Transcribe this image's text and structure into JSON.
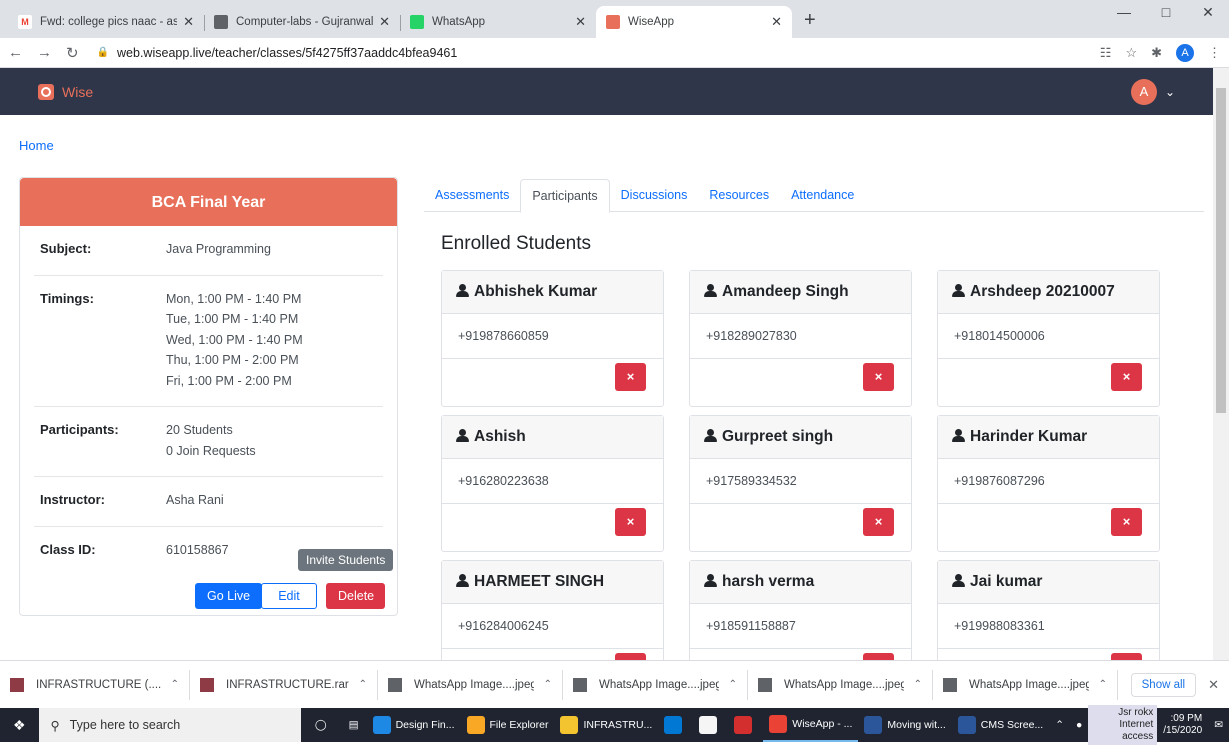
{
  "browser": {
    "tabs": [
      {
        "title": "Fwd: college pics naac - asharani",
        "fav_color": "#ffffff",
        "fav_text": "M",
        "fav_text_color": "#ea4335"
      },
      {
        "title": "Computer-labs - Gujranwala Guru",
        "fav_color": "#5f6368",
        "fav_text": "",
        "fav_text_color": "#ffffff"
      },
      {
        "title": "WhatsApp",
        "fav_color": "#25d366",
        "fav_text": "",
        "fav_text_color": "#ffffff"
      },
      {
        "title": "WiseApp",
        "fav_color": "#e8705a",
        "fav_text": "",
        "fav_text_color": "#ffffff",
        "active": true
      }
    ],
    "new_tab": "+",
    "url": "web.wiseapp.live/teacher/classes/5f4275ff37aaddc4bfea9461",
    "profile_initial": "A"
  },
  "app": {
    "brand": "Wise",
    "user_initial": "A",
    "breadcrumb": "Home"
  },
  "class": {
    "title": "BCA Final Year",
    "rows": [
      {
        "label": "Subject:",
        "value": "Java Programming"
      },
      {
        "label": "Timings:",
        "value": "Mon, 1:00 PM - 1:40 PM\nTue, 1:00 PM - 1:40 PM\nWed, 1:00 PM - 1:40 PM\nThu, 1:00 PM - 2:00 PM\nFri, 1:00 PM - 2:00 PM"
      },
      {
        "label": "Participants:",
        "value": "20 Students\n0 Join Requests"
      },
      {
        "label": "Instructor:",
        "value": "Asha Rani"
      },
      {
        "label": "Class ID:",
        "value": "610158867"
      }
    ],
    "invite_label": "Invite Students",
    "go_live_label": "Go Live",
    "edit_label": "Edit",
    "delete_label": "Delete"
  },
  "tabs": [
    "Assessments",
    "Participants",
    "Discussions",
    "Resources",
    "Attendance"
  ],
  "active_tab": "Participants",
  "enrolled_heading": "Enrolled Students",
  "students": [
    {
      "name": "Abhishek Kumar",
      "phone": "+919878660859"
    },
    {
      "name": "Amandeep Singh",
      "phone": "+918289027830"
    },
    {
      "name": "Arshdeep 20210007",
      "phone": "+918014500006"
    },
    {
      "name": "Ashish",
      "phone": "+916280223638"
    },
    {
      "name": "Gurpreet singh",
      "phone": "+917589334532"
    },
    {
      "name": "Harinder Kumar",
      "phone": "+919876087296"
    },
    {
      "name": "HARMEET SINGH",
      "phone": "+916284006245"
    },
    {
      "name": "harsh verma",
      "phone": "+918591158887"
    },
    {
      "name": "Jai kumar",
      "phone": "+919988083361"
    }
  ],
  "remove_glyph": "×",
  "downloads": [
    {
      "name": "INFRASTRUCTURE (....rar",
      "icon": "#8e3b46"
    },
    {
      "name": "INFRASTRUCTURE.rar",
      "icon": "#8e3b46"
    },
    {
      "name": "WhatsApp Image....jpeg",
      "icon": "#5f6368"
    },
    {
      "name": "WhatsApp Image....jpeg",
      "icon": "#5f6368"
    },
    {
      "name": "WhatsApp Image....jpeg",
      "icon": "#5f6368"
    },
    {
      "name": "WhatsApp Image....jpeg",
      "icon": "#5f6368"
    }
  ],
  "show_all_label": "Show all",
  "taskbar": {
    "search_placeholder": "Type here to search",
    "items": [
      {
        "label": "Design Fin...",
        "color": "#1e88e5"
      },
      {
        "label": "File Explorer",
        "color": "#f9a825"
      },
      {
        "label": "INFRASTRU...",
        "color": "#f4c430"
      },
      {
        "label": "",
        "color": "#0078d4"
      },
      {
        "label": "",
        "color": "#f5f5f5"
      },
      {
        "label": "",
        "color": "#d32f2f"
      },
      {
        "label": "WiseApp - ...",
        "color": "#ea4335",
        "open": true
      },
      {
        "label": "Moving wit...",
        "color": "#2b579a"
      },
      {
        "label": "CMS Scree...",
        "color": "#2b579a"
      }
    ],
    "network_name": "Jsr rokx",
    "network_status": "Internet access",
    "time": ":09 PM",
    "date": "/15/2020"
  }
}
